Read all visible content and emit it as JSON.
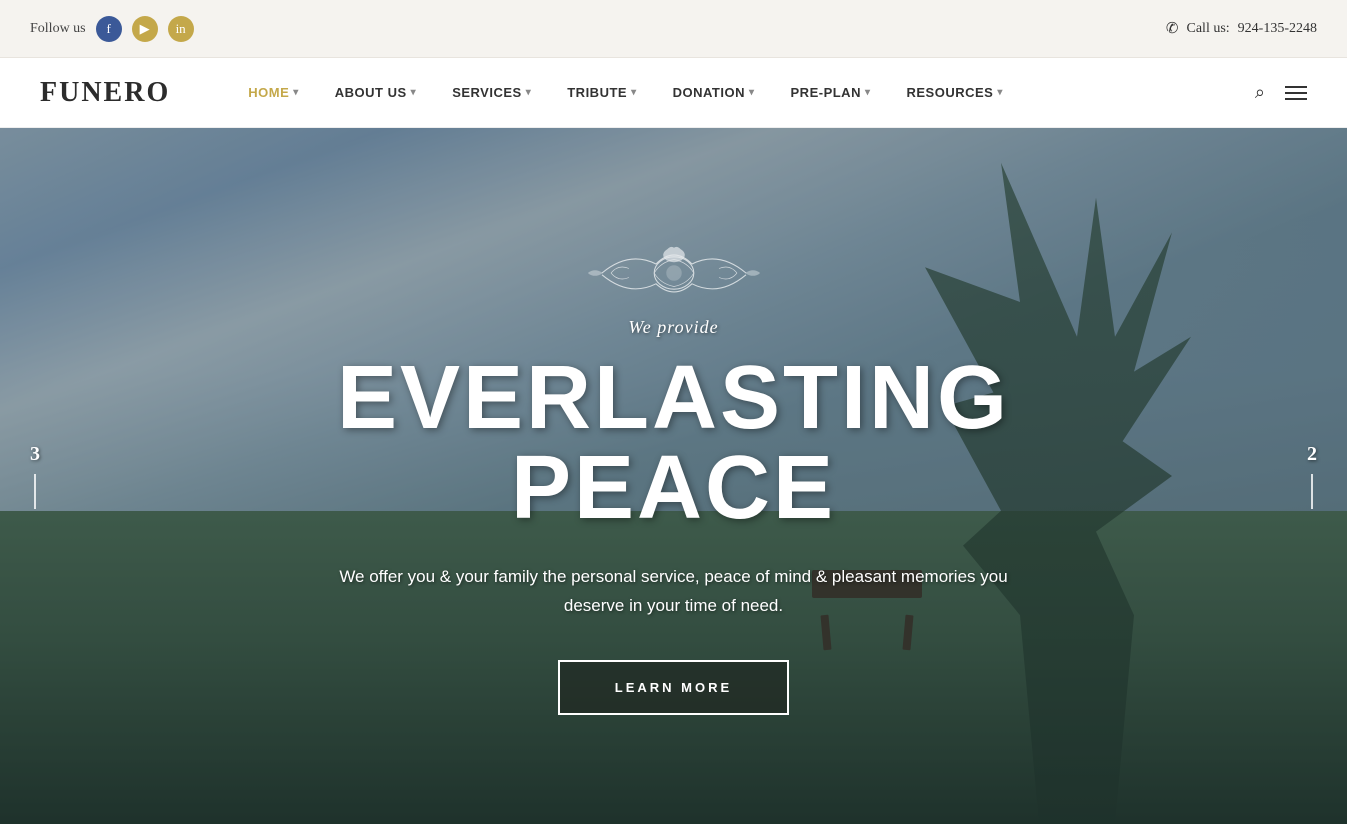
{
  "topbar": {
    "follow_label": "Follow us",
    "call_label": "Call us:",
    "phone": "924-135-2248",
    "social": [
      {
        "name": "Facebook",
        "icon": "f"
      },
      {
        "name": "YouTube",
        "icon": "▶"
      },
      {
        "name": "LinkedIn",
        "icon": "in"
      }
    ]
  },
  "nav": {
    "logo": "FUNERO",
    "items": [
      {
        "label": "HOME",
        "active": true,
        "has_dropdown": true
      },
      {
        "label": "ABOUT US",
        "active": false,
        "has_dropdown": true
      },
      {
        "label": "SERVICES",
        "active": false,
        "has_dropdown": true
      },
      {
        "label": "TRIBUTE",
        "active": false,
        "has_dropdown": true
      },
      {
        "label": "DONATION",
        "active": false,
        "has_dropdown": true
      },
      {
        "label": "PRE-PLAN",
        "active": false,
        "has_dropdown": true
      },
      {
        "label": "RESOURCES",
        "active": false,
        "has_dropdown": true
      }
    ]
  },
  "hero": {
    "subtitle": "We provide",
    "title": "EVERLASTING PEACE",
    "description": "We offer you & your family the personal service, peace of mind & pleasant memories you deserve in your time of need.",
    "cta_label": "LEARN MORE",
    "slide_left": "3",
    "slide_right": "2"
  }
}
